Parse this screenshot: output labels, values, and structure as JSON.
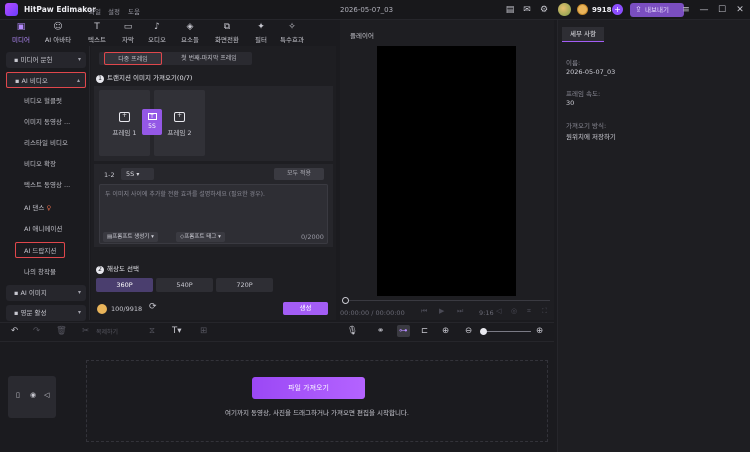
{
  "app": {
    "name": "HitPaw Edimakor",
    "menus": [
      "파일",
      "설정",
      "도움"
    ],
    "project_title": "2026-05-07_03",
    "credits": "9918",
    "export_label": "내보내기"
  },
  "tabs": [
    {
      "label": "미디어",
      "icon": "media-icon"
    },
    {
      "label": "AI 아바타",
      "icon": "avatar-icon"
    },
    {
      "label": "텍스트",
      "icon": "text-icon"
    },
    {
      "label": "자막",
      "icon": "subtitle-icon"
    },
    {
      "label": "오디오",
      "icon": "audio-icon"
    },
    {
      "label": "요소들",
      "icon": "elements-icon"
    },
    {
      "label": "화면전환",
      "icon": "transition-icon"
    },
    {
      "label": "필터",
      "icon": "filter-icon"
    },
    {
      "label": "특수효과",
      "icon": "effects-icon"
    }
  ],
  "sidebar": {
    "media_library": "미디어 문헌",
    "ai_video": "AI 비디오",
    "sub_items": [
      "비디오 헐클럿",
      "이미지 동영상 ...",
      "리스타일 비디오",
      "비디오 확장",
      "텍스트 동영상 ...",
      "AI 댄스",
      "AI 애니메이션",
      "AI 드랍지션",
      "나의 창작물"
    ],
    "ai_image": "AI 이미지",
    "drawing": "영문 활성"
  },
  "center": {
    "mode_tabs": [
      "다중 프레임",
      "첫 번째-마지막 프레임"
    ],
    "step1": "트랜지션 이미지 가져오기(0/7)",
    "frame1": "프레임 1",
    "frame2": "프레임 2",
    "transition_duration": "5S",
    "range_label": "1-2",
    "duration_value": "5S",
    "apply_all": "모두 적용",
    "prompt_placeholder": "두 이미지 사이에 추가할 전환 효과를 설명하세요 (필요한 경우).",
    "prompt_generator": "프롬프트 생성기",
    "prompt_tags": "프롬프트 태그",
    "char_count": "0/2000",
    "step2": "해상도 선택",
    "resolutions": [
      "360P",
      "540P",
      "720P"
    ],
    "credit_line": "100/9918",
    "generate": "생성"
  },
  "player": {
    "title": "플레이어",
    "time_current": "00:00:00 / 00:00:00",
    "ratio": "9:16"
  },
  "details": {
    "tab": "세부 사항",
    "name_label": "이름:",
    "name_value": "2026-05-07_03",
    "fps_label": "프레임 속도:",
    "fps_value": "30",
    "import_label": "가져오기 방식:",
    "import_value": "원위치에 저장하기"
  },
  "toolbar": {
    "duplicate": "복제하기"
  },
  "timeline": {
    "import_button": "파일 가져오기",
    "hint": "여기까지 동영상, 사진을 드래그하거나 가져오면 편집을 시작합니다."
  }
}
